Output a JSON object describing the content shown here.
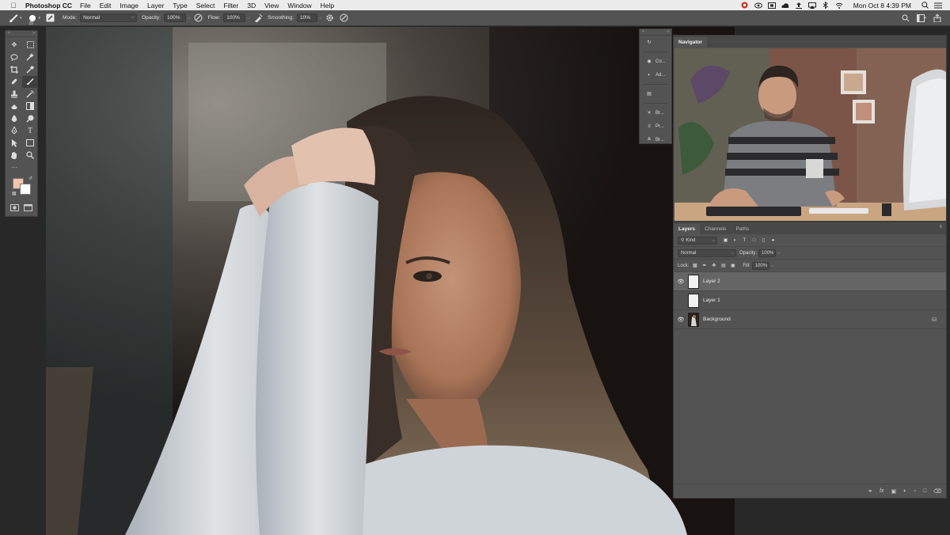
{
  "menubar": {
    "app_name": "Photoshop CC",
    "menus": [
      "File",
      "Edit",
      "Image",
      "Layer",
      "Type",
      "Select",
      "Filter",
      "3D",
      "View",
      "Window",
      "Help"
    ],
    "clock": "Mon Oct 8  4:39 PM"
  },
  "options": {
    "brush_size": "25",
    "mode_label": "Mode:",
    "mode_value": "Normal",
    "opacity_label": "Opacity:",
    "opacity_value": "100%",
    "flow_label": "Flow:",
    "flow_value": "100%",
    "smoothing_label": "Smoothing:",
    "smoothing_value": "10%"
  },
  "toolbar": {
    "foreground_color": "#f2c4ae",
    "background_color": "#ffffff"
  },
  "strip": {
    "items": [
      "Co...",
      "Ad...",
      "Br...",
      "Pr...",
      "Br..."
    ]
  },
  "navigator": {
    "tab": "Navigator"
  },
  "layers_panel": {
    "tabs": [
      "Layers",
      "Channels",
      "Paths"
    ],
    "filter_kind": "Kind",
    "blend_mode": "Normal",
    "opacity_label": "Opacity:",
    "opacity_value": "100%",
    "lock_label": "Lock:",
    "fill_label": "Fill:",
    "fill_value": "100%",
    "layers": [
      {
        "name": "Layer 2",
        "visible": true,
        "selected": true
      },
      {
        "name": "Layer 1",
        "visible": false,
        "selected": false
      },
      {
        "name": "Background",
        "visible": true,
        "selected": false,
        "locked": true
      }
    ]
  }
}
